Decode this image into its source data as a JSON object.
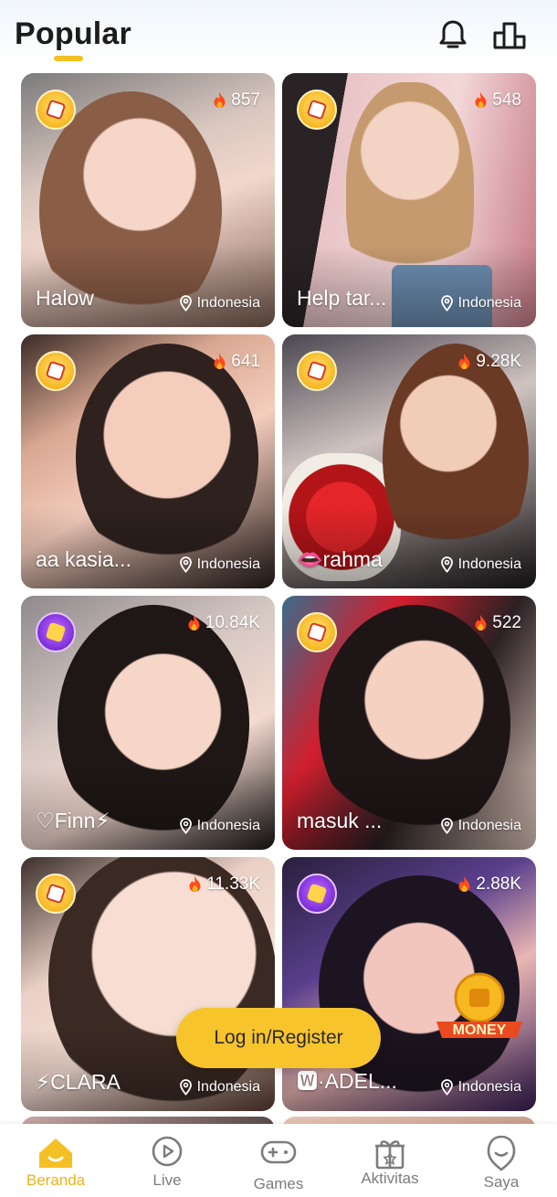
{
  "header": {
    "title": "Popular",
    "notification_icon": "bell-icon",
    "ranking_icon": "leaderboard-icon"
  },
  "colors": {
    "accent": "#f5c023",
    "tab_active": "#f2b21a",
    "tab_inactive": "#7c7c7c"
  },
  "cards": [
    {
      "name": "Halow",
      "viewers": "857",
      "location": "Indonesia",
      "badge": "sicbo-badge"
    },
    {
      "name": "Help tar...",
      "viewers": "548",
      "location": "Indonesia",
      "badge": "sicbo-badge"
    },
    {
      "name": "aa kasia...",
      "viewers": "641",
      "location": "Indonesia",
      "badge": "sicbo-badge"
    },
    {
      "name": "👄rahma",
      "viewers": "9.28K",
      "location": "Indonesia",
      "badge": "sicbo-badge"
    },
    {
      "name": "♡Finn⚡",
      "viewers": "10.84K",
      "location": "Indonesia",
      "badge": "fsat-badge"
    },
    {
      "name": "masuk ...",
      "viewers": "522",
      "location": "Indonesia",
      "badge": "sicbo-badge"
    },
    {
      "name": "⚡CLARA",
      "viewers": "11.33K",
      "location": "Indonesia",
      "badge": "sicbo-badge"
    },
    {
      "name": "🆆·ADEL...",
      "viewers": "2.88K",
      "location": "Indonesia",
      "badge": "fsat-badge"
    }
  ],
  "login_button": "Log in/Register",
  "money_badge": "MONEY",
  "tabs": [
    {
      "label": "Beranda",
      "icon": "home-icon",
      "active": true
    },
    {
      "label": "Live",
      "icon": "live-icon",
      "active": false
    },
    {
      "label": "Games",
      "icon": "gamepad-icon",
      "active": false
    },
    {
      "label": "Aktivitas",
      "icon": "gift-icon",
      "active": false
    },
    {
      "label": "Saya",
      "icon": "profile-icon",
      "active": false
    }
  ]
}
